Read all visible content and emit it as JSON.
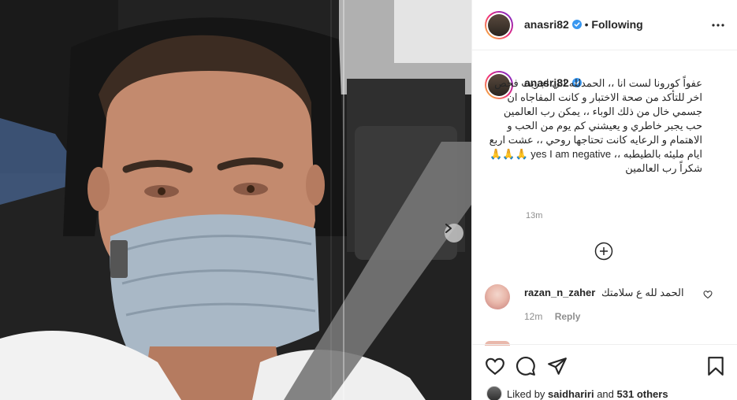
{
  "post": {
    "username": "anasri82",
    "separator": "•",
    "follow_status": "Following",
    "more_icon": "more-horizontal-icon",
    "verified_icon": "verified-badge-icon"
  },
  "caption": {
    "username": "anasri82",
    "text": "عفواً كورونا لست انا ،، الحمدلله اني اجريت فحص اخر للتأكد من صحة الاختبار و كانت المفاجاه ان جسمي خال من ذلك الوباء ،، يمكن رب العالمين حب يجبر خاطري و يعيشني كم يوم من الحب و الاهتمام و الرعايه كانت تحتاجها روحي ،، عشت اربع ايام مليئه بالطيطبه ،، yes I am negative 🙏🙏🙏 شكراً رب العالمين",
    "time": "13m",
    "load_more_icon": "plus-circle-icon"
  },
  "comments": [
    {
      "username": "razan_n_zaher",
      "text": "الحمد لله ع سلامتك",
      "time": "12m",
      "reply_label": "Reply",
      "like_icon": "heart-outline-icon"
    }
  ],
  "actions": {
    "like_icon": "heart-icon",
    "comment_icon": "comment-icon",
    "share_icon": "paper-plane-icon",
    "save_icon": "bookmark-icon"
  },
  "likes": {
    "prefix": "Liked by",
    "user": "saidhariri",
    "connector": "and",
    "others": "531 others"
  },
  "colors": {
    "verified": "#3897f0",
    "text": "#262626",
    "muted": "#8e8e8e",
    "border": "#efefef"
  }
}
